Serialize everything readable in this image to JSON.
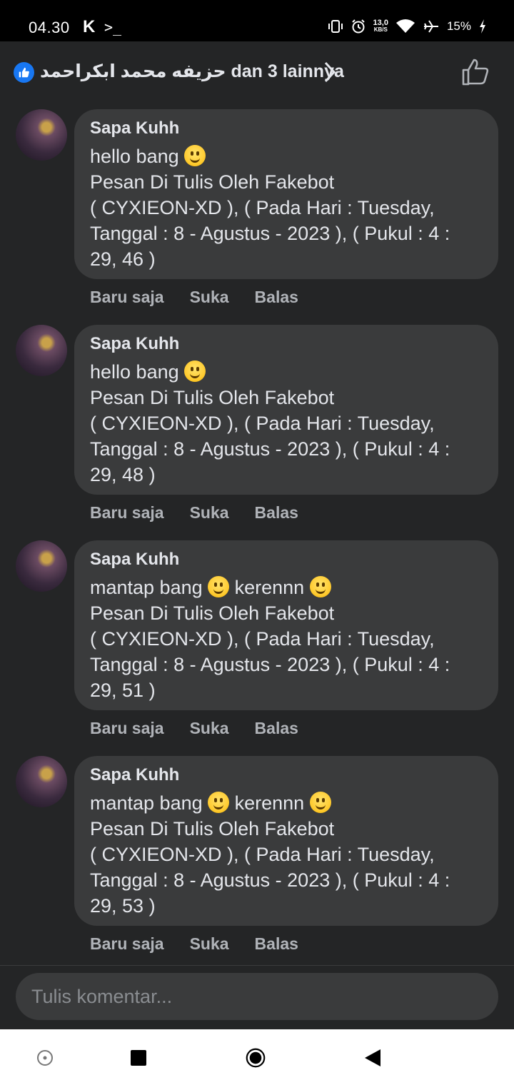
{
  "status_bar": {
    "time": "04.30",
    "app_k": "K",
    "terminal": ">_",
    "speed_value": "13,0",
    "speed_unit": "KB/S",
    "battery": "15%"
  },
  "header": {
    "reactor_arabic": "حزيفه محمد ابكراحمد",
    "reactor_suffix": "dan 3 lainnya"
  },
  "comments": [
    {
      "author": "Sapa Kuhh",
      "line1_a": "hello bang ",
      "line1_b": "",
      "emoji_count": 1,
      "line2": "Pesan Di Tulis Oleh Fakebot",
      "line3": "( CYXIEON-XD ), ( Pada Hari : Tuesday,",
      "line4": "Tanggal : 8 - Agustus - 2023 ), ( Pukul : 4 :",
      "line5": "29, 46 )",
      "time": "Baru saja",
      "like": "Suka",
      "reply": "Balas"
    },
    {
      "author": "Sapa Kuhh",
      "line1_a": "hello bang ",
      "line1_b": "",
      "emoji_count": 1,
      "line2": "Pesan Di Tulis Oleh Fakebot",
      "line3": "( CYXIEON-XD ), ( Pada Hari : Tuesday,",
      "line4": "Tanggal : 8 - Agustus - 2023 ), ( Pukul : 4 :",
      "line5": "29, 48 )",
      "time": "Baru saja",
      "like": "Suka",
      "reply": "Balas"
    },
    {
      "author": "Sapa Kuhh",
      "line1_a": "mantap bang ",
      "line1_b": " kerennn ",
      "emoji_count": 2,
      "line2": "Pesan Di Tulis Oleh Fakebot",
      "line3": "( CYXIEON-XD ), ( Pada Hari : Tuesday,",
      "line4": "Tanggal : 8 - Agustus - 2023 ), ( Pukul : 4 :",
      "line5": "29, 51 )",
      "time": "Baru saja",
      "like": "Suka",
      "reply": "Balas"
    },
    {
      "author": "Sapa Kuhh",
      "line1_a": "mantap bang ",
      "line1_b": " kerennn ",
      "emoji_count": 2,
      "line2": "Pesan Di Tulis Oleh Fakebot",
      "line3": "( CYXIEON-XD ), ( Pada Hari : Tuesday,",
      "line4": "Tanggal : 8 - Agustus - 2023 ), ( Pukul : 4 :",
      "line5": "29, 53 )",
      "time": "Baru saja",
      "like": "Suka",
      "reply": "Balas"
    }
  ],
  "composer": {
    "placeholder": "Tulis komentar..."
  },
  "colors": {
    "background": "#242526",
    "bubble": "#3a3b3c",
    "like_blue": "#1877f2",
    "secondary_text": "#b0b3b8"
  },
  "icons": {
    "header_like_badge": "thumbs-up-icon",
    "header_chevron": "chevron-right-icon",
    "header_like_button": "thumbs-up-outline-icon",
    "nav": [
      "circle-dot-icon",
      "square-stop-icon",
      "home-circle-icon",
      "back-triangle-icon"
    ]
  }
}
